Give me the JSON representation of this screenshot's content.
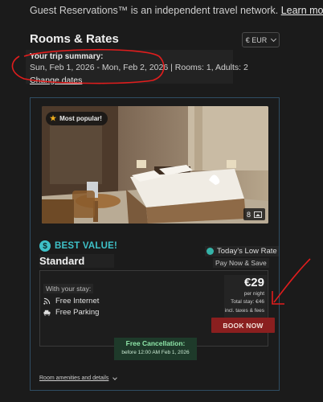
{
  "header": {
    "disclaimer_text": "Guest Reservations™ is an independent travel network.",
    "learn_more_link": "Learn more"
  },
  "rooms_rates": {
    "title": "Rooms & Rates",
    "currency": "€ EUR"
  },
  "trip_summary": {
    "title": "Your trip summary:",
    "dates": "Sun, Feb 1, 2026 - Mon, Feb 2, 2026",
    "rooms_adults": "Rooms: 1, Adults: 2",
    "change_dates_link": "Change dates"
  },
  "room_card": {
    "badge": "Most popular!",
    "photo_count": "8",
    "best_value_icon": "$",
    "best_value_label": "BEST VALUE!",
    "room_name": "Standard",
    "low_rate_label": "Today's Low Rate",
    "pay_label": "Pay Now & Save",
    "stay_label": "With your stay:",
    "amenities": [
      {
        "icon": "wifi-icon",
        "label": "Free Internet"
      },
      {
        "icon": "parking-icon",
        "label": "Free Parking"
      }
    ],
    "price": "€29",
    "per_night": "per night",
    "total_stay": "Total stay: €46",
    "incl_taxes": "incl. taxes & fees",
    "book_button": "BOOK NOW",
    "cancellation_title": "Free Cancellation:",
    "cancellation_deadline": "before 12:00 AM Feb 1, 2026",
    "details_link": "Room amenities and details"
  },
  "colors": {
    "background": "#1b1b1b",
    "accent_teal": "#3ec1c8",
    "book_button": "#8a1f1f",
    "annotation_red": "#e11d1d",
    "card_border": "#2f4d63"
  }
}
